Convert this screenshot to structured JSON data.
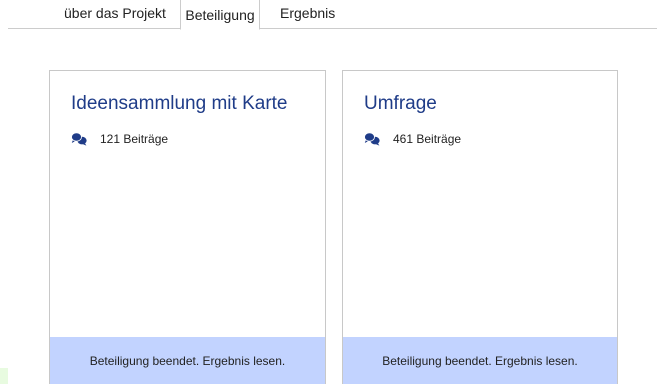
{
  "tabs": [
    {
      "label": "über das Projekt"
    },
    {
      "label": "Beteiligung"
    },
    {
      "label": "Ergebnis"
    }
  ],
  "active_tab": "Beteiligung",
  "cards": [
    {
      "title": "Ideensammlung mit Karte",
      "contributions": "121 Beiträge",
      "footer": "Beteiligung beendet. Ergebnis lesen."
    },
    {
      "title": "Umfrage",
      "contributions": "461 Beiträge",
      "footer": "Beteiligung beendet. Ergebnis lesen."
    }
  ],
  "icons": {
    "contributions": "comments-icon"
  },
  "colors": {
    "title": "#1f3c88",
    "footer_bg": "#c2d3ff",
    "icon": "#1f3c88"
  }
}
